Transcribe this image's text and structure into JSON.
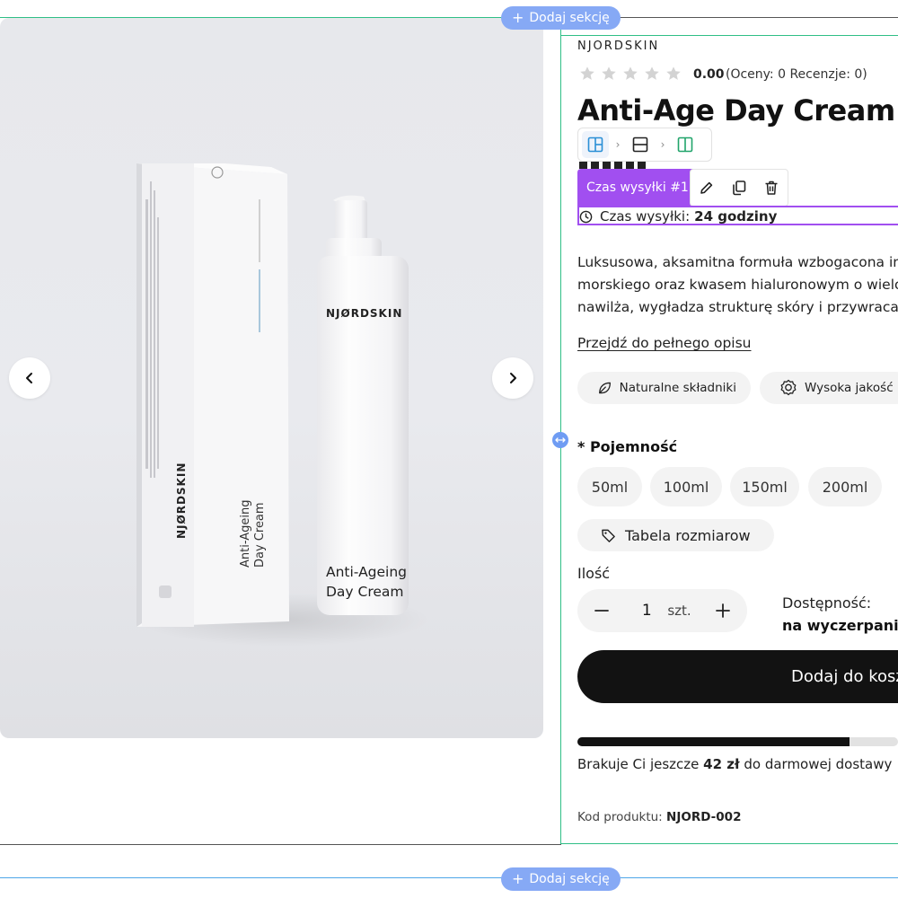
{
  "editor": {
    "add_section_top": "Dodaj sekcję",
    "add_section_bottom": "Dodaj sekcję",
    "layout_toolbar": {
      "icons": [
        "layout-mixed-icon",
        "layout-rows-icon",
        "layout-columns-icon"
      ]
    },
    "selected_block": {
      "tag_label": "Czas wysyłki #1",
      "actions": [
        "edit-icon",
        "duplicate-icon",
        "delete-icon"
      ]
    },
    "colors": {
      "section_guide": "#2fbf86",
      "add_section_button": "#86a9f5",
      "selected_block": "#a14ff0"
    }
  },
  "gallery": {
    "prev_icon": "chevron-left-icon",
    "next_icon": "chevron-right-icon",
    "product_photo": {
      "box_brand": "NJØRDSKIN",
      "box_product": [
        "Anti-Ageing",
        "Day Cream"
      ],
      "bottle_brand": "NJØRDSKIN",
      "bottle_product": [
        "Anti-Ageing",
        "Day Cream"
      ]
    }
  },
  "product": {
    "brand": "NJORDSKIN",
    "rating": {
      "stars": 5,
      "filled": 0,
      "value": "0.00",
      "counts": "(Oceny: 0 Recenzje: 0)"
    },
    "title": "Anti-Age Day Cream",
    "shipping": {
      "label": "Czas wysyłki:",
      "value": "24 godziny"
    },
    "description_lines": [
      "Luksusowa, aksamitna formuła wzbogacona inn",
      "morskiego oraz kwasem hialuronowym o wielo",
      "nawilża, wygładza strukturę skóry i przywraca je"
    ],
    "full_description_link": "Przejdź do pełnego opisu",
    "features": [
      {
        "icon": "leaf-icon",
        "label": "Naturalne składniki"
      },
      {
        "icon": "quality-badge-icon",
        "label": "Wysoka jakość"
      }
    ],
    "variant": {
      "required_mark": "*",
      "label": "Pojemność",
      "options": [
        "50ml",
        "100ml",
        "150ml",
        "200ml"
      ]
    },
    "size_table": "Tabela rozmiarow",
    "quantity": {
      "label": "Ilość",
      "value": "1",
      "unit": "szt."
    },
    "availability": {
      "label": "Dostępność:",
      "value": "na wyczerpaniu"
    },
    "add_to_cart": "Dodaj do kosz",
    "free_shipping": {
      "progress": 0.85,
      "prefix": "Brakuje Ci jeszcze",
      "amount": "42 zł",
      "suffix": "do darmowej dostawy"
    },
    "sku": {
      "label": "Kod produktu:",
      "value": "NJORD-002"
    }
  }
}
